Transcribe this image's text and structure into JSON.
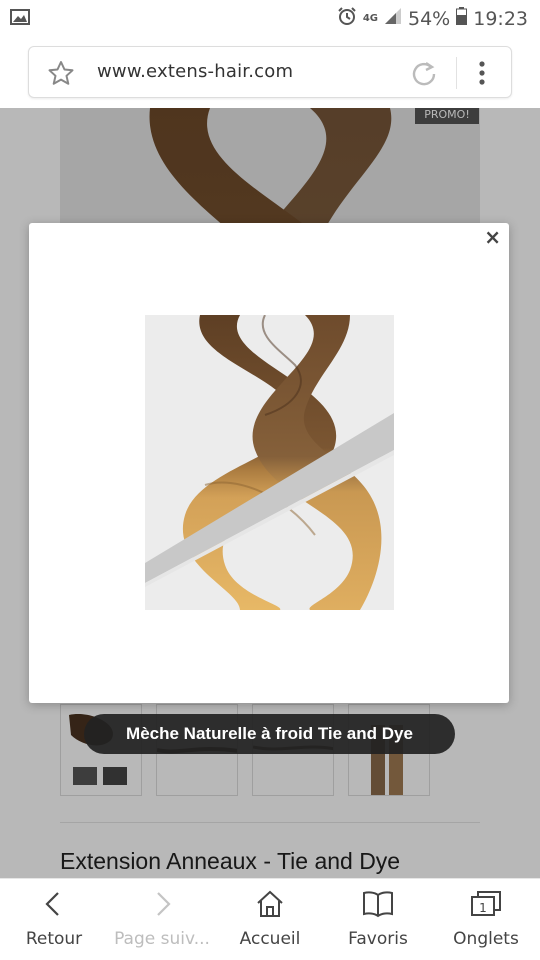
{
  "status_bar": {
    "network": "4G",
    "battery": "54%",
    "time": "19:23"
  },
  "address_bar": {
    "url": "www.extens-hair.com"
  },
  "page": {
    "promo_badge": "PROMO!",
    "product_title": "Extension Anneaux - Tie and Dye"
  },
  "modal": {
    "close_glyph": "×",
    "caption": "Mèche Naturelle à froid Tie and Dye"
  },
  "bottom_nav": {
    "back": "Retour",
    "forward": "Page suiv...",
    "home": "Accueil",
    "favorites": "Favoris",
    "tabs": "Onglets",
    "tabs_count": "1"
  },
  "colors": {
    "hair_dark": "#6b4a2c",
    "hair_light": "#d9a85a",
    "overlay": "rgba(0,0,0,0.28)",
    "caption_bg": "#222222"
  }
}
